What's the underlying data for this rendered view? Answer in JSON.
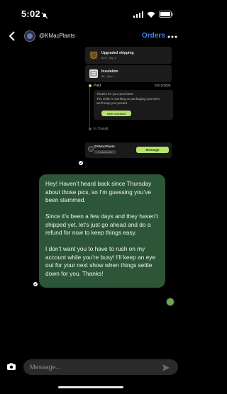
{
  "status_bar": {
    "time": "5:02"
  },
  "header": {
    "username": "@KMacPlants",
    "orders_label": "Orders"
  },
  "order_card": {
    "items": [
      {
        "title": "Upgraded shipping",
        "sub": "$15 · Qty: 1",
        "icon": "ups-icon"
      },
      {
        "title": "Insulation",
        "sub": "$5 · Qty: 1",
        "icon": "insulation-icon"
      }
    ],
    "paid_label": "Paid",
    "paid_date": "02/12/2026",
    "message_lines": [
      "Thanks for your purchase!",
      "The seller is working on packaging your item;",
      "we'll keep you posted."
    ],
    "item_received_label": "Item received",
    "in_transit_label": "In Transit",
    "seller_name": "@KMacPlants",
    "contact_label": "Contact seller",
    "message_button_label": "Message"
  },
  "bubble": {
    "paragraphs": [
      "Hey! Haven’t heard back since Thursday about those pics, so I’m guessing you’ve been slammed.",
      "Since it’s been a few days and they haven’t shipped yet, let’s just go ahead and do a refund for now to keep things easy.",
      "I don’t want you to have to rush on my account while you’re busy! I’ll keep an eye out for your next show when things settle down for you. Thanks!"
    ]
  },
  "composer": {
    "placeholder": "Message..."
  },
  "colors": {
    "accent": "#3b82f6",
    "bubble": "#2d5638",
    "lime": "#b5e36b"
  }
}
